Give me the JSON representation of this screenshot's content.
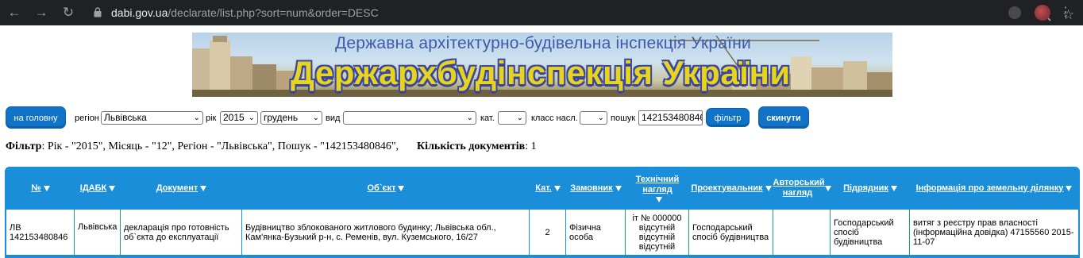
{
  "browser": {
    "url_host": "dabi.gov.ua",
    "url_path": "/declarate/list.php?sort=num&order=DESC"
  },
  "banner": {
    "subtitle": "Державна архітектурно-будівельна інспекція України",
    "title": "Держархбудінспекція України"
  },
  "filters": {
    "home_button": "на головну",
    "region_label": "регіон",
    "region_value": "Львівська",
    "year_label": "рік",
    "year_value": "2015",
    "month_value": "грудень",
    "type_label": "вид",
    "type_value": "",
    "category_label": "кат.",
    "category_value": "",
    "settlement_label": "класс насл.",
    "settlement_value": "",
    "search_label": "пошук",
    "search_value": "142153480846",
    "filter_button": "фільтр",
    "reset_button": "скинути"
  },
  "summary": {
    "filter_label": "Фільтр",
    "filter_text": ": Рік - \"2015\", Місяць - \"12\", Регіон - \"Львівська\", Пошук - \"142153480846\",",
    "count_label": "Кількість документів",
    "count_value": ": 1"
  },
  "table": {
    "headers": [
      "№",
      "ІДАБК",
      "Документ",
      "Об`єкт",
      "Кат.",
      "Замовник",
      "Технічний нагляд",
      "Проектувальник",
      "Авторський нагляд",
      "Підрядник",
      "Інформація про земельну ділянку"
    ],
    "row": {
      "num": "ЛВ 142153480846",
      "idabk": "Львівська",
      "document": "декларація про готовність об`єкта до експлуатації",
      "object": "Будівництво зблокованого житлового будинку; Львівська обл., Кам'янка-Бузький р-н, с. Ременів, вул. Куземського, 16/27",
      "category": "2",
      "customer": "Фізична особа",
      "tech_supervision": "іт № 000000 відсутній відсутній відсутній",
      "designer": "Господарський спосіб будівництва",
      "author_supervision": "",
      "contractor": "Господарський спосіб будівництва",
      "land_info": "витяг з реєстру прав власності (інформаційна довідка) 47155560 2015-11-07"
    }
  }
}
